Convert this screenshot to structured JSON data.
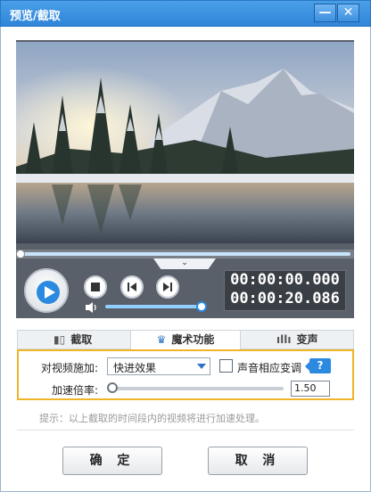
{
  "window": {
    "title": "预览/截取",
    "minimize_glyph": "—",
    "close_glyph": "✕"
  },
  "player": {
    "current_time": "00:00:00.000",
    "total_time": "00:00:20.086",
    "toggle_glyph": "⌄",
    "seek_progress": 0,
    "volume_level": 0.95
  },
  "tabs": [
    {
      "label": "截取",
      "icon": "film-cut-icon"
    },
    {
      "label": "魔术功能",
      "icon": "magic-hat-icon",
      "active": true
    },
    {
      "label": "变声",
      "icon": "sound-wave-icon"
    }
  ],
  "magic": {
    "apply_label": "对视频施加:",
    "effect_value": "快进效果",
    "pitch_label": "声音相应变调",
    "pitch_checked": false,
    "help_label": "?",
    "rate_label": "加速倍率:",
    "rate_value": "1.50"
  },
  "hint": "提示：以上截取的时间段内的视频将进行加速处理。",
  "buttons": {
    "ok": "确 定",
    "cancel": "取 消"
  },
  "colors": {
    "titlebar": "#3a90e0",
    "accent": "#2b8ae0",
    "panel_border": "#f0b429"
  }
}
